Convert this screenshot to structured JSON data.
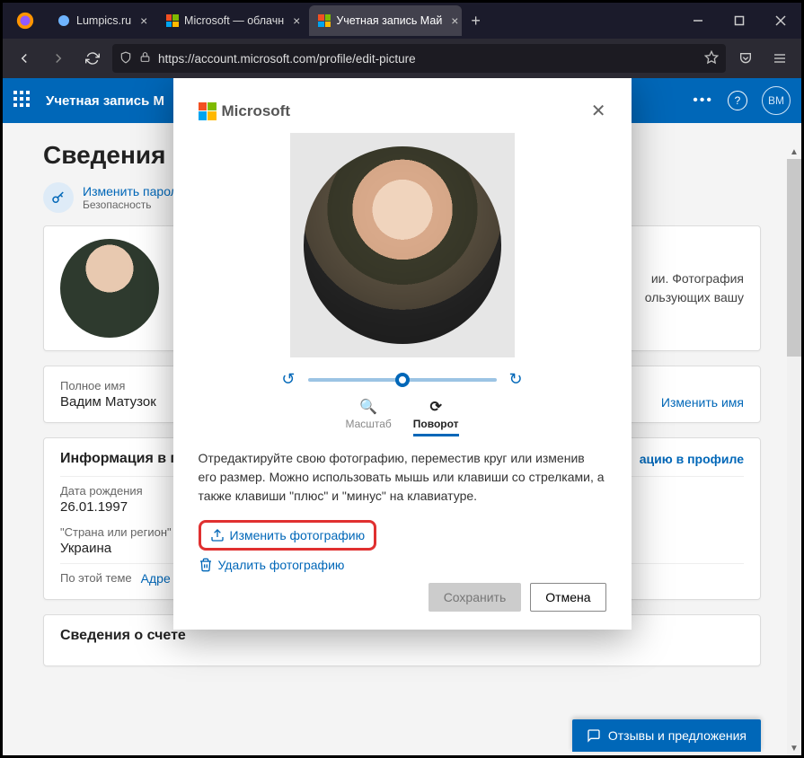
{
  "browser": {
    "tabs": [
      {
        "title": "Lumpics.ru",
        "active": false
      },
      {
        "title": "Microsoft — облачн",
        "active": false
      },
      {
        "title": "Учетная запись Май",
        "active": true
      }
    ],
    "url": "https://account.microsoft.com/profile/edit-picture"
  },
  "header": {
    "title": "Учетная запись М",
    "avatar_initials": "ВМ"
  },
  "page": {
    "heading": "Сведения",
    "key_link": "Изменить парол",
    "key_sub": "Безопасность",
    "photo_text_1": "ии. Фотография",
    "photo_text_2": "ользующих вашу",
    "fullname_label": "Полное имя",
    "fullname_value": "Вадим Матузок",
    "edit_name": "Изменить имя",
    "profile_info_title": "Информация в про",
    "profile_info_link": "ацию в профиле",
    "dob_label": "Дата рождения",
    "dob_value": "26.01.1997",
    "country_label": "\"Страна или регион\"",
    "country_value": "Украина",
    "related_label": "По этой теме",
    "related_link": "Адре",
    "account_info_title": "Сведения о счете",
    "feedback": "Отзывы и предложения"
  },
  "modal": {
    "brand": "Microsoft",
    "tab_zoom": "Масштаб",
    "tab_rotate": "Поворот",
    "instructions": "Отредактируйте свою фотографию, переместив круг или изменив его размер. Можно использовать мышь или клавиши со стрелками, а также клавиши \"плюс\" и \"минус\" на клавиатуре.",
    "change_photo": "Изменить фотографию",
    "delete_photo": "Удалить фотографию",
    "save": "Сохранить",
    "cancel": "Отмена"
  }
}
